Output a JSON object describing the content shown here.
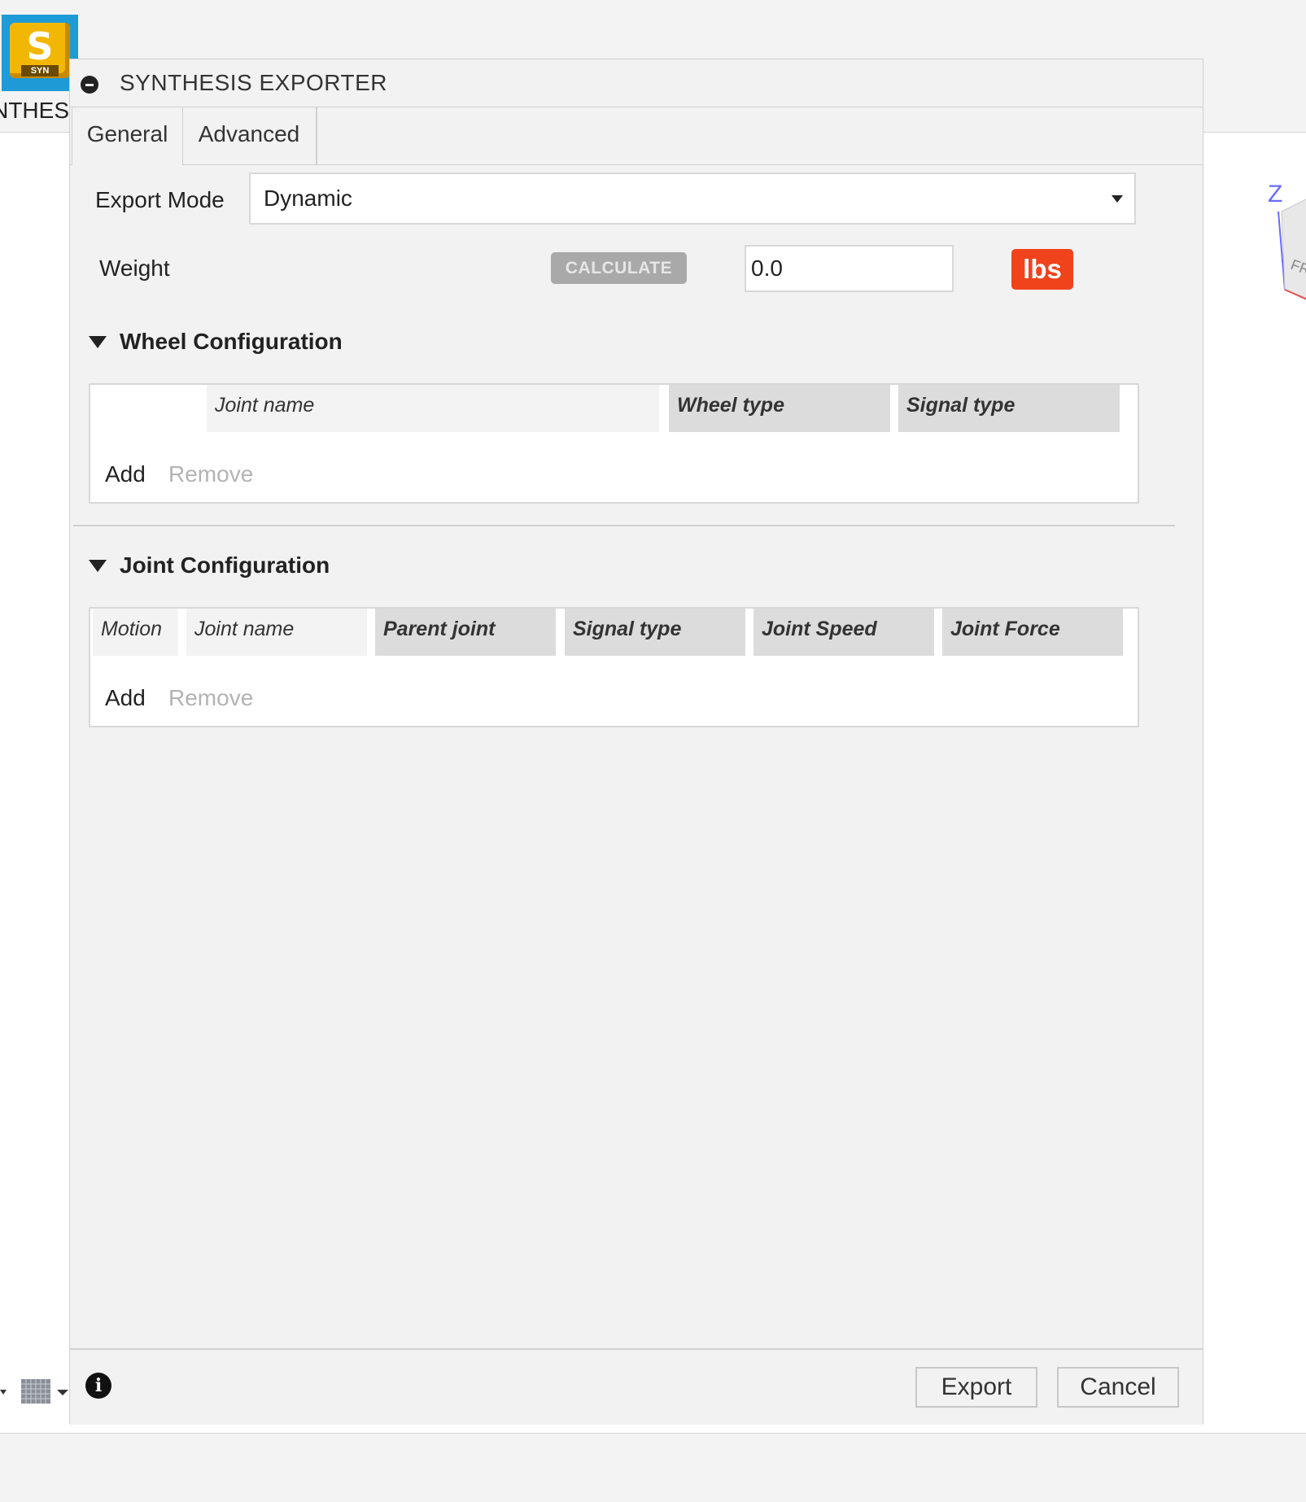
{
  "app": {
    "icon_letter": "S",
    "icon_sub": "SYN",
    "label": "NTHES"
  },
  "viewcube": {
    "axis_label": "Z",
    "face_label": "FR"
  },
  "dialog": {
    "title": "SYNTHESIS EXPORTER",
    "tabs": [
      {
        "label": "General",
        "active": true
      },
      {
        "label": "Advanced",
        "active": false
      }
    ],
    "export_mode": {
      "label": "Export Mode",
      "value": "Dynamic"
    },
    "weight": {
      "label": "Weight",
      "calculate_label": "CALCULATE",
      "value": "0.0",
      "unit_label": "lbs"
    },
    "wheel_config": {
      "title": "Wheel Configuration",
      "columns": [
        "Joint name",
        "Wheel type",
        "Signal type"
      ],
      "add_label": "Add",
      "remove_label": "Remove"
    },
    "joint_config": {
      "title": "Joint Configuration",
      "columns": [
        "Motion",
        "Joint name",
        "Parent joint",
        "Signal type",
        "Joint Speed",
        "Joint Force"
      ],
      "add_label": "Add",
      "remove_label": "Remove"
    },
    "footer": {
      "info_glyph": "i",
      "export_label": "Export",
      "cancel_label": "Cancel"
    }
  },
  "colors": {
    "accent_unit": "#f0431c",
    "calc_disabled": "#a9a9a9",
    "icon_blue": "#1e9bd7",
    "icon_yellow": "#f2b705"
  }
}
